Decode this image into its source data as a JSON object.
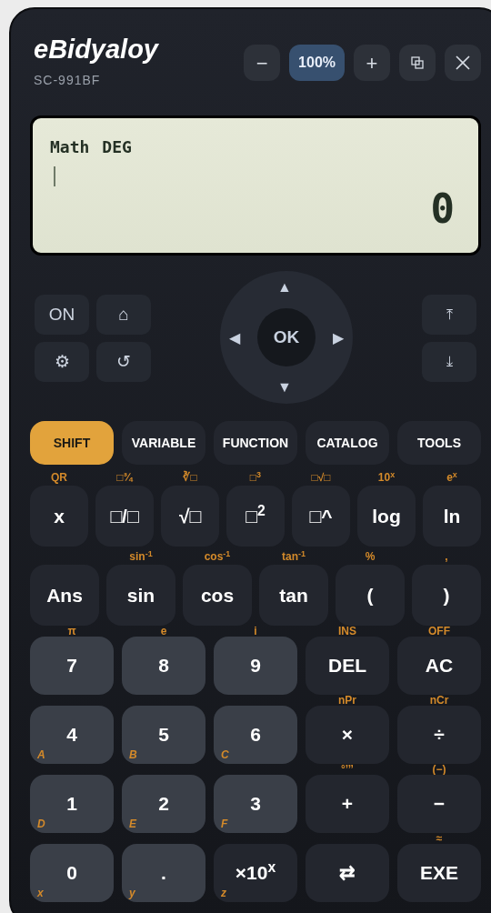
{
  "header": {
    "title": "eBidyaloy",
    "model": "SC-991BF",
    "toolbar": [
      {
        "kind": "text",
        "label": "−"
      },
      {
        "kind": "zoom",
        "label": "100%"
      },
      {
        "kind": "text",
        "label": "+"
      },
      {
        "kind": "restore"
      },
      {
        "kind": "close"
      }
    ]
  },
  "display": {
    "mode": "Math",
    "angle": "DEG",
    "result": "0"
  },
  "nav": {
    "left_keys": [
      {
        "label": "ON"
      },
      {
        "label": "⌂"
      },
      {
        "label": "⚙"
      },
      {
        "label": "↺"
      }
    ],
    "ok": "OK",
    "up": "▲",
    "left": "◀",
    "right": "▶",
    "down": "▼",
    "right_keys": [
      {
        "label": "⤒"
      },
      {
        "label": "⤓"
      }
    ]
  },
  "soft_keys": [
    {
      "label": "SHIFT",
      "kind": "shift"
    },
    {
      "label": "VARIABLE",
      "kind": "menu"
    },
    {
      "label": "FUNCTION",
      "kind": "menu"
    },
    {
      "label": "CATALOG",
      "kind": "menu"
    },
    {
      "label": "TOOLS",
      "kind": "menu"
    }
  ],
  "keypad": [
    {
      "keys": [
        {
          "label": "x",
          "shift": "QR",
          "kind": "func"
        },
        {
          "label": "□/□",
          "shift": "□¾",
          "kind": "func"
        },
        {
          "label": "√□",
          "shift": "∛□",
          "kind": "func"
        },
        {
          "label": "□$^{2}$",
          "shift": "□$^{3}$",
          "kind": "func"
        },
        {
          "label": "□^",
          "shift": "□√□",
          "kind": "func"
        },
        {
          "label": "log",
          "shift": "10$^{x}$",
          "kind": "func"
        },
        {
          "label": "ln",
          "shift": "e$^{x}$",
          "kind": "func"
        }
      ]
    },
    {
      "keys": [
        {
          "label": "Ans",
          "kind": "func"
        },
        {
          "label": "sin",
          "shift": "sin$^{-1}$",
          "kind": "func"
        },
        {
          "label": "cos",
          "shift": "cos$^{-1}$",
          "kind": "func"
        },
        {
          "label": "tan",
          "shift": "tan$^{-1}$",
          "kind": "func"
        },
        {
          "label": "(",
          "shift": "%",
          "kind": "func"
        },
        {
          "label": ")",
          "shift": ",",
          "kind": "func"
        }
      ]
    },
    {
      "keys": [
        {
          "label": "7",
          "shift": "π",
          "kind": "digit"
        },
        {
          "label": "8",
          "shift": "e",
          "kind": "digit"
        },
        {
          "label": "9",
          "shift": "i",
          "kind": "digit"
        },
        {
          "label": "DEL",
          "shift": "INS",
          "kind": "func"
        },
        {
          "label": "AC",
          "shift": "OFF",
          "kind": "func"
        }
      ]
    },
    {
      "keys": [
        {
          "label": "4",
          "alpha": "A",
          "kind": "digit"
        },
        {
          "label": "5",
          "alpha": "B",
          "kind": "digit"
        },
        {
          "label": "6",
          "alpha": "C",
          "kind": "digit"
        },
        {
          "label": "×",
          "shift": "nPr",
          "kind": "func"
        },
        {
          "label": "÷",
          "shift": "nCr",
          "kind": "func"
        }
      ]
    },
    {
      "keys": [
        {
          "label": "1",
          "alpha": "D",
          "kind": "digit"
        },
        {
          "label": "2",
          "alpha": "E",
          "kind": "digit"
        },
        {
          "label": "3",
          "alpha": "F",
          "kind": "digit"
        },
        {
          "label": "+",
          "shift": "°’’’",
          "kind": "func"
        },
        {
          "label": "−",
          "shift": "(−)",
          "kind": "func"
        }
      ]
    },
    {
      "keys": [
        {
          "label": "0",
          "alpha": "x",
          "kind": "digit"
        },
        {
          "label": ".",
          "alpha": "y",
          "kind": "digit"
        },
        {
          "label": "×10$^{x}$",
          "alpha": "z",
          "kind": "func"
        },
        {
          "label": "⇄",
          "kind": "func"
        },
        {
          "label": "EXE",
          "shift": "≈",
          "kind": "func"
        }
      ]
    }
  ]
}
